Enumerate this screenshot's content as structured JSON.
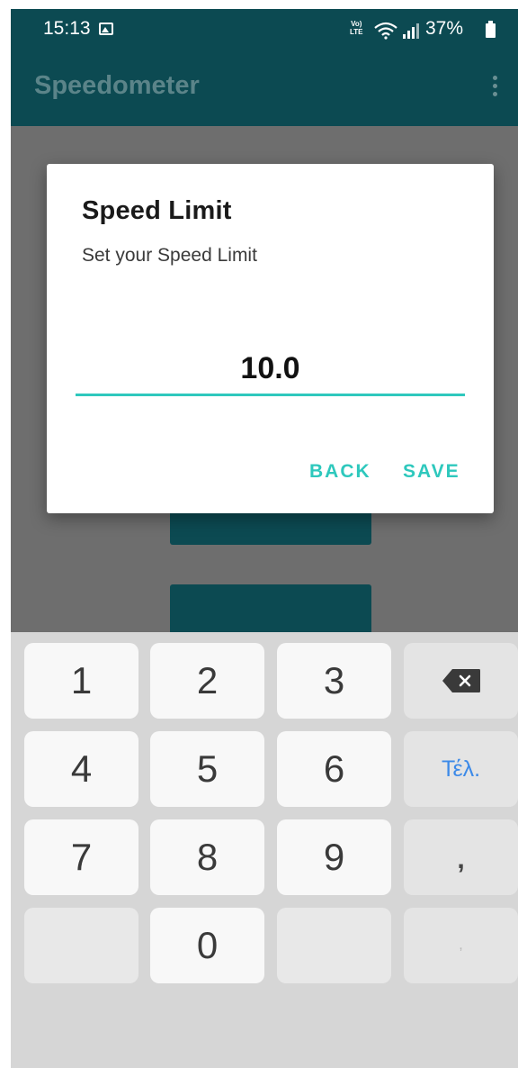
{
  "status_bar": {
    "time": "15:13",
    "volte_label": "Vo) LTE",
    "battery": "37%"
  },
  "app_bar": {
    "title": "Speedometer",
    "overflow_icon": "more-vert-icon"
  },
  "dialog": {
    "title": "Speed Limit",
    "message": "Set your Speed Limit",
    "input_value": "10.0",
    "back_label": "BACK",
    "save_label": "SAVE"
  },
  "keyboard": {
    "row1": [
      "1",
      "2",
      "3"
    ],
    "row2": [
      "4",
      "5",
      "6"
    ],
    "row3": [
      "7",
      "8",
      "9"
    ],
    "row4": [
      "0"
    ],
    "done_label": "Τέλ.",
    "comma_label": ",",
    "dot_label": ",",
    "backspace_icon": "backspace-icon"
  },
  "colors": {
    "primary": "#0c4a52",
    "accent": "#2ec8bd",
    "done_blue": "#3d8ae8"
  }
}
